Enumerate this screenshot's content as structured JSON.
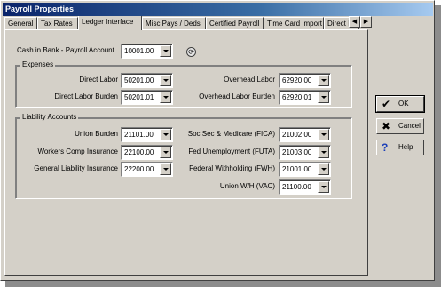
{
  "window": {
    "title": "Payroll Properties"
  },
  "tabs": [
    {
      "label": "General",
      "active": false
    },
    {
      "label": "Tax Rates",
      "active": false
    },
    {
      "label": "Ledger Interface",
      "active": true
    },
    {
      "label": "Misc Pays / Deds",
      "active": false
    },
    {
      "label": "Certified Payroll",
      "active": false
    },
    {
      "label": "Time Card Import",
      "active": false
    },
    {
      "label": "Direct I",
      "active": false
    }
  ],
  "cash_in_bank": {
    "label": "Cash in Bank - Payroll Account",
    "value": "10001.00"
  },
  "expenses": {
    "title": "Expenses",
    "direct_labor": {
      "label": "Direct  Labor",
      "value": "50201.00"
    },
    "direct_labor_burden": {
      "label": "Direct Labor Burden",
      "value": "50201.01"
    },
    "overhead_labor": {
      "label": "Overhead Labor",
      "value": "62920.00"
    },
    "overhead_labor_burden": {
      "label": "Overhead Labor Burden",
      "value": "62920.01"
    }
  },
  "liability": {
    "title": "Liability Accounts",
    "union_burden": {
      "label": "Union Burden",
      "value": "21101.00"
    },
    "workers_comp": {
      "label": "Workers Comp Insurance",
      "value": "22100.00"
    },
    "general_liability": {
      "label": "General Liability Insurance",
      "value": "22200.00"
    },
    "fica": {
      "label": "Soc Sec & Medicare (FICA)",
      "value": "21002.00"
    },
    "futa": {
      "label": "Fed Unemployment (FUTA)",
      "value": "21003.00"
    },
    "fwh": {
      "label": "Federal Withholding (FWH)",
      "value": "21001.00"
    },
    "union_wh": {
      "label": "Union W/H (VAC)",
      "value": "21100.00"
    }
  },
  "buttons": {
    "ok": "OK",
    "cancel": "Cancel",
    "help": "Help"
  },
  "icons": {
    "ok": "check-icon",
    "cancel": "x-icon",
    "help": "question-icon"
  },
  "colors": {
    "title_start": "#0a246a",
    "title_end": "#a6caf0",
    "face": "#d4d0c8"
  }
}
